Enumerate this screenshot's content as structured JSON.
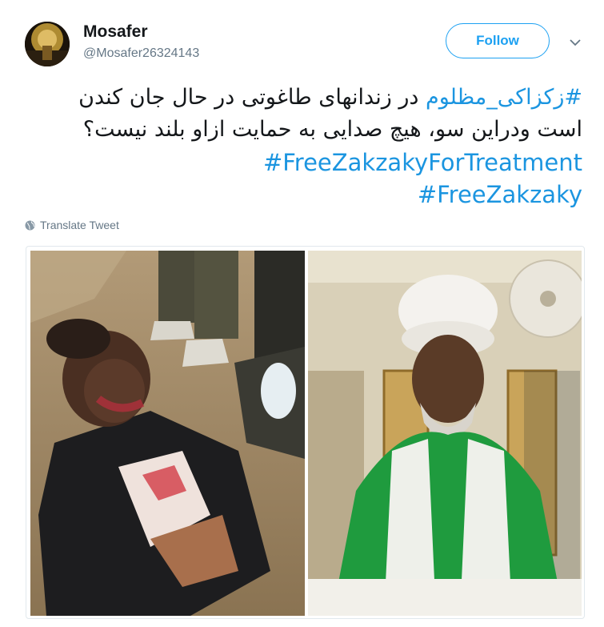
{
  "user": {
    "display_name": "Mosafer",
    "handle": "@Mosafer26324143",
    "avatar_icon": "avatar-photo"
  },
  "actions": {
    "follow_label": "Follow",
    "menu_icon": "chevron-down-icon"
  },
  "tweet": {
    "line1_hashtag": "#زکزاکی_مظلوم",
    "line1_text": " در زندانهای طاغوتی در حال جان کندن",
    "line2_text": "است ودراین سو، هیچ صدایی به حمایت ازاو بلند  نیست؟",
    "hashtags": [
      "#FreeZakzakyForTreatment",
      "#FreeZakzaky"
    ]
  },
  "translate": {
    "label": "Translate Tweet",
    "icon": "globe-icon"
  },
  "colors": {
    "accent": "#1da1f2",
    "link": "#1b95e0",
    "secondary_text": "#657786",
    "border": "#e1e8ed"
  }
}
